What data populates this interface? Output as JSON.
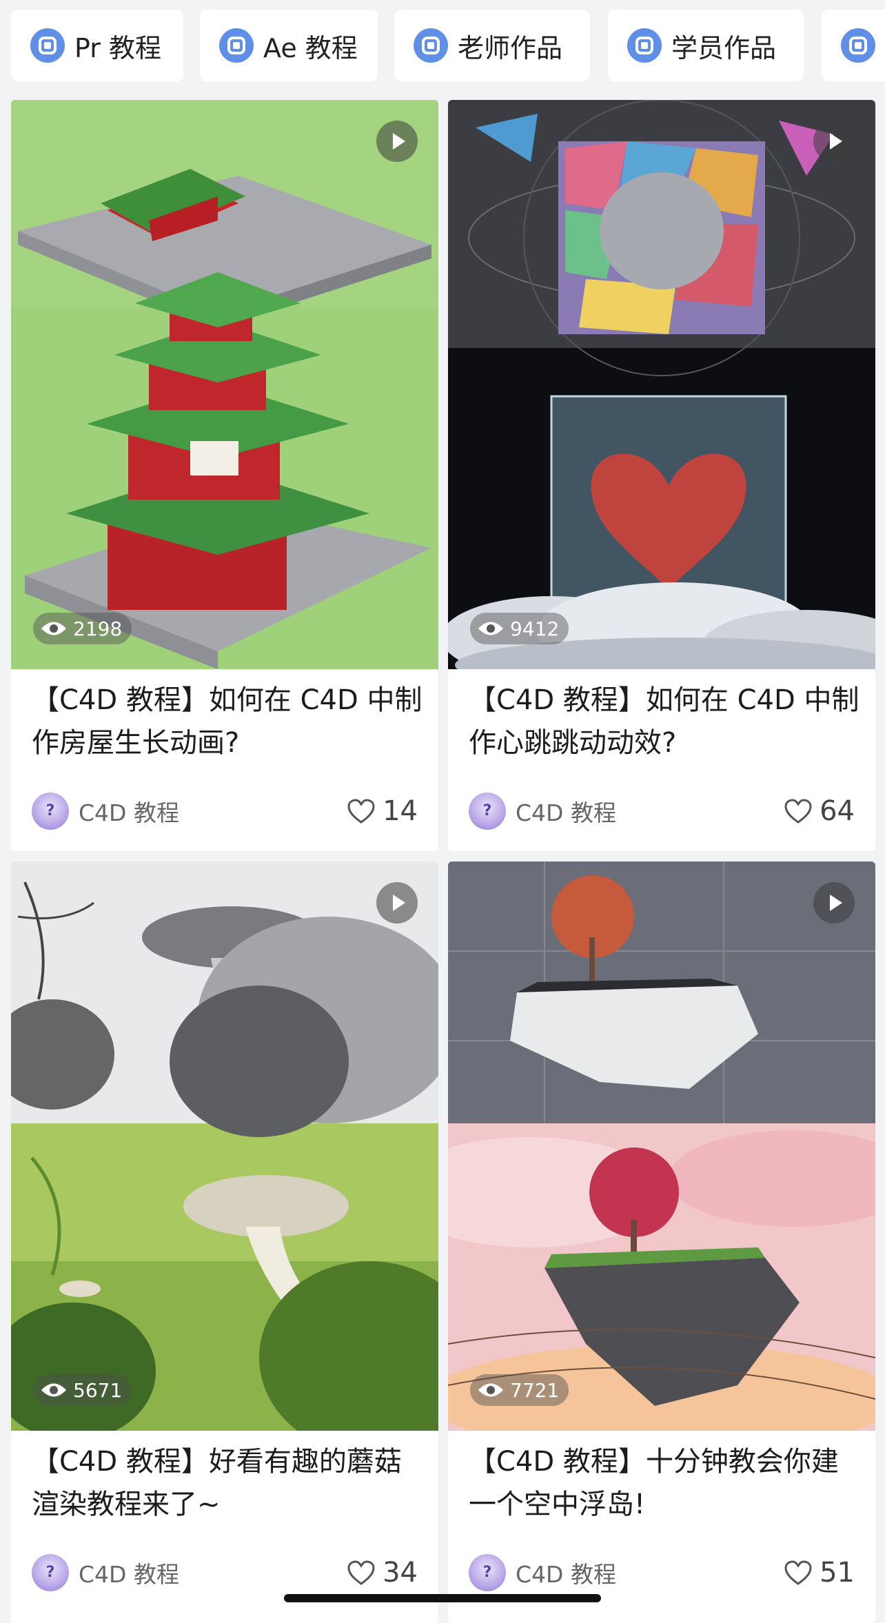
{
  "tabs": [
    {
      "label": "Pr 教程",
      "icon": "course-icon"
    },
    {
      "label": "Ae 教程",
      "icon": "course-icon"
    },
    {
      "label": "老师作品",
      "icon": "course-icon"
    },
    {
      "label": "学员作品",
      "icon": "course-icon"
    },
    {
      "label": "",
      "icon": "course-icon"
    }
  ],
  "cards": [
    {
      "title": "【C4D 教程】如何在 C4D 中制作房屋生长动画?",
      "views": "2198",
      "author": "C4D 教程",
      "likes": "14",
      "thumbnail": "chinese-pavilion-render"
    },
    {
      "title": "【C4D 教程】如何在 C4D 中制作心跳跳动动效?",
      "views": "9412",
      "author": "C4D 教程",
      "likes": "64",
      "thumbnail": "heart-in-glass-cube-render"
    },
    {
      "title": "【C4D 教程】好看有趣的蘑菇渲染教程来了~",
      "views": "5671",
      "author": "C4D 教程",
      "likes": "34",
      "thumbnail": "mushroom-render"
    },
    {
      "title": "【C4D 教程】十分钟教会你建一个空中浮岛!",
      "views": "7721",
      "author": "C4D 教程",
      "likes": "51",
      "thumbnail": "floating-island-render"
    }
  ],
  "colors": {
    "background": "#f2f3f5",
    "tab_icon": "#5f8fe6",
    "card": "#ffffff"
  }
}
